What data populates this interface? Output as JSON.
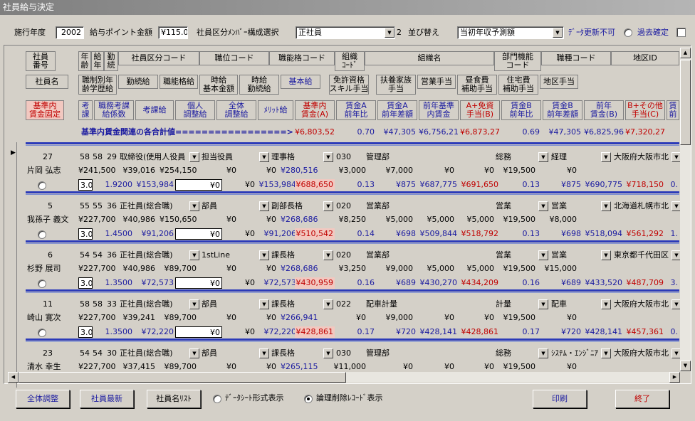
{
  "window": {
    "title": "社員給与決定"
  },
  "toolbar": {
    "fiscal_year_label": "施行年度",
    "fiscal_year_value": "2002",
    "pay_point_label": "給与ポイント金額",
    "pay_point_value": "¥115.0",
    "division_label": "社員区分ﾒﾝﾊﾞｰ構成選択",
    "division_value": "正社員",
    "division_num": "2",
    "sort_label": "並び替え",
    "sort_value": "当初年収予測額",
    "no_update_label": "ﾃﾞｰﾀ更新不可",
    "past_confirm_label": "過去確定"
  },
  "headers": {
    "row1": [
      "社員\n番号",
      "年\n齢",
      "給\n年",
      "勤\n続",
      "社員区分コード",
      "職位コード",
      "職能格コード",
      "組織\nｺｰﾄﾞ",
      "組織名",
      "部門機能\nコード",
      "職種コード",
      "地区ID"
    ],
    "row2": [
      "社員名",
      "職制別年\n齢学歴給",
      "勤続給",
      "職能格給",
      "時給\n基本金額",
      "時給\n勤続給",
      "基本給",
      "免許資格\nスキル手当",
      "扶養家族\n手当",
      "営業手当",
      "昼食費\n補助手当",
      "住宅費\n補助手当",
      "地区手当"
    ],
    "row3": [
      "基準内\n賃金固定",
      "考\n課",
      "職務考課\n給係数",
      "考課給",
      "個人\n調整給",
      "全体\n調整給",
      "ﾒﾘｯﾄ給",
      "基準内\n賃金(A)",
      "賃金A\n前年比",
      "賃金A\n前年差額",
      "前年基準\n内賃金",
      "A+免資\n手当(B)",
      "賃金B\n前年比",
      "賃金B\n前年差額",
      "前年\n賃金(B)",
      "B+その他\n手当(C)",
      "賃\n前"
    ]
  },
  "summary": {
    "label": "基準内賃金関連の各合計値=================>",
    "values": [
      "¥6,803,522",
      "0.70",
      "¥47,305",
      "¥6,756,217",
      "¥6,873,272",
      "0.69",
      "¥47,305",
      "¥6,825,967",
      "¥7,320,272"
    ]
  },
  "records": [
    {
      "id": "27",
      "age": "58",
      "kyunen": "58",
      "kinzoku": "29",
      "division": "取締役(使用人役員",
      "position": "担当役員",
      "grade": "理事格",
      "org_code": "030",
      "org_name": "管理部",
      "func": "総務",
      "job": "経理",
      "area": "大阪府大阪市北",
      "name": "片岡 弘志",
      "r2": [
        "¥241,500",
        "¥39,016",
        "¥254,150",
        "¥0",
        "¥0",
        "¥280,516",
        "¥3,000",
        "¥7,000",
        "¥0",
        "¥0",
        "¥19,500",
        "¥0"
      ],
      "r3": [
        "3.0",
        "1.9200",
        "¥153,984",
        "¥0",
        "¥0",
        "¥153,984",
        "¥688,650",
        "0.13",
        "¥875",
        "¥687,775",
        "¥691,650",
        "0.13",
        "¥875",
        "¥690,775",
        "¥718,150",
        "0."
      ]
    },
    {
      "id": "5",
      "age": "55",
      "kyunen": "55",
      "kinzoku": "36",
      "division": "正社員(総合職)",
      "position": "部員",
      "grade": "副部長格",
      "org_code": "020",
      "org_name": "営業部",
      "func": "営業",
      "job": "営業",
      "area": "北海道札幌市北",
      "name": "我孫子 義文",
      "r2": [
        "¥227,700",
        "¥40,986",
        "¥150,650",
        "¥0",
        "¥0",
        "¥268,686",
        "¥8,250",
        "¥5,000",
        "¥5,000",
        "¥5,000",
        "¥19,500",
        "¥8,000"
      ],
      "r3": [
        "3.0",
        "1.4500",
        "¥91,206",
        "¥0",
        "¥0",
        "¥91,206",
        "¥510,542",
        "0.14",
        "¥698",
        "¥509,844",
        "¥518,792",
        "0.13",
        "¥698",
        "¥518,094",
        "¥561,292",
        "1."
      ]
    },
    {
      "id": "6",
      "age": "54",
      "kyunen": "54",
      "kinzoku": "36",
      "division": "正社員(総合職)",
      "position": "1stLine",
      "grade": "課長格",
      "org_code": "020",
      "org_name": "営業部",
      "func": "営業",
      "job": "営業",
      "area": "東京都千代田区",
      "name": "杉野 展司",
      "r2": [
        "¥227,700",
        "¥40,986",
        "¥89,700",
        "¥0",
        "¥0",
        "¥268,686",
        "¥3,250",
        "¥9,000",
        "¥5,000",
        "¥5,000",
        "¥19,500",
        "¥15,000"
      ],
      "r3": [
        "3.0",
        "1.3500",
        "¥72,573",
        "¥0",
        "¥0",
        "¥72,573",
        "¥430,959",
        "0.16",
        "¥689",
        "¥430,270",
        "¥434,209",
        "0.16",
        "¥689",
        "¥433,520",
        "¥487,709",
        "3."
      ]
    },
    {
      "id": "11",
      "age": "58",
      "kyunen": "58",
      "kinzoku": "33",
      "division": "正社員(総合職)",
      "position": "部員",
      "grade": "課長格",
      "org_code": "022",
      "org_name": "配車計量",
      "func": "計量",
      "job": "配車",
      "area": "大阪府大阪市北",
      "name": "崎山 寛次",
      "r2": [
        "¥227,700",
        "¥39,241",
        "¥89,700",
        "¥0",
        "¥0",
        "¥266,941",
        "¥0",
        "¥9,000",
        "¥0",
        "¥0",
        "¥19,500",
        "¥0"
      ],
      "r3": [
        "3.0",
        "1.3500",
        "¥72,220",
        "¥0",
        "¥0",
        "¥72,220",
        "¥428,861",
        "0.17",
        "¥720",
        "¥428,141",
        "¥428,861",
        "0.17",
        "¥720",
        "¥428,141",
        "¥457,361",
        "0."
      ]
    },
    {
      "id": "23",
      "age": "54",
      "kyunen": "54",
      "kinzoku": "30",
      "division": "正社員(総合職)",
      "position": "部員",
      "grade": "課長格",
      "org_code": "030",
      "org_name": "管理部",
      "func": "総務",
      "job": "ｼｽﾃﾑ・ｴﾝｼﾞﾆｱ",
      "area": "大阪府大阪市北",
      "name": "清水 幸生",
      "r2": [
        "¥227,700",
        "¥37,415",
        "¥89,700",
        "¥0",
        "¥0",
        "¥265,115",
        "¥11,000",
        "¥0",
        "¥0",
        "¥0",
        "¥19,500",
        "¥0"
      ],
      "r3": []
    }
  ],
  "footer": {
    "btn_adjust_all": "全体調整",
    "btn_refresh": "社員最新",
    "btn_name_list": "社員名ﾘｽﾄ",
    "radio_datasheet": "ﾃﾞｰﾀｼｰﾄ形式表示",
    "radio_logical_delete": "論理削除ﾚｺｰﾄﾞ表示",
    "btn_print": "印刷",
    "btn_exit": "終了"
  }
}
